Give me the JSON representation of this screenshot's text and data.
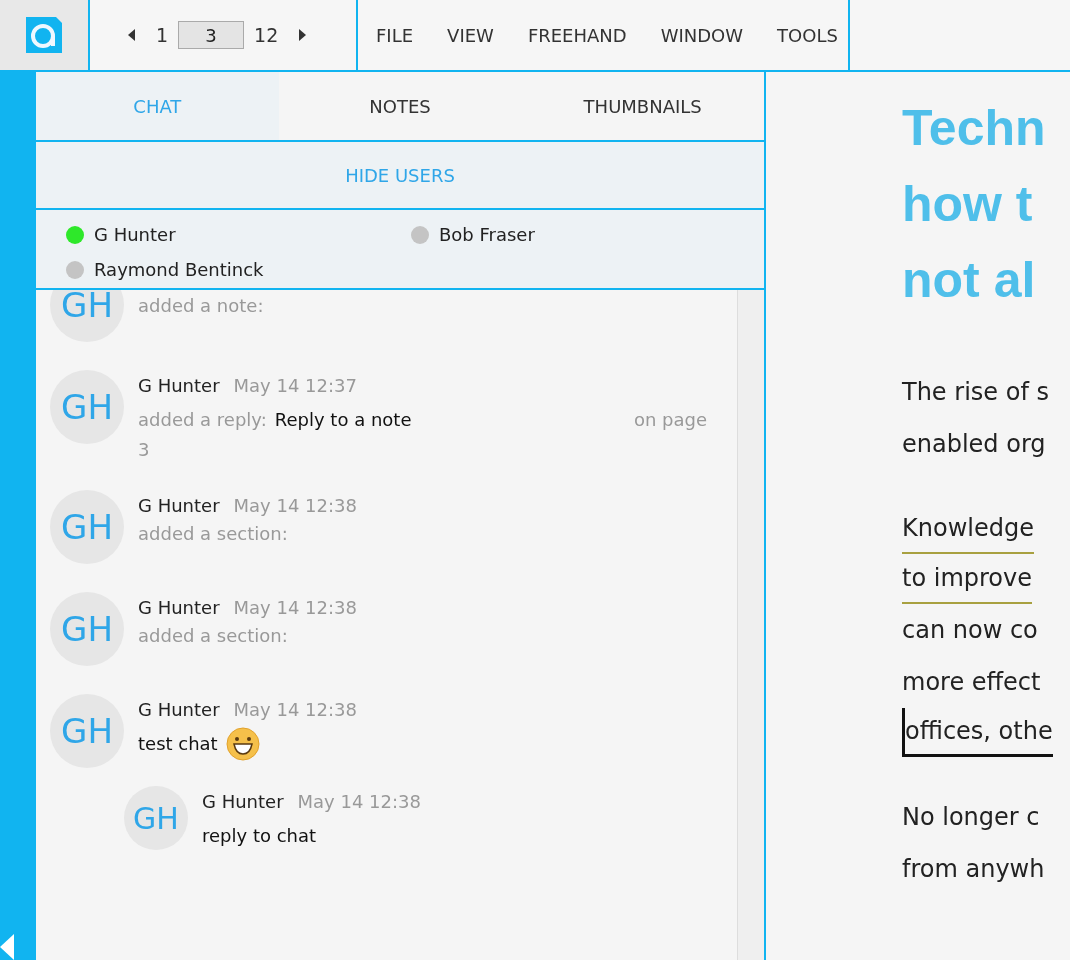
{
  "pager": {
    "first": "1",
    "current": "3",
    "last": "12"
  },
  "menu": [
    "FILE",
    "VIEW",
    "FREEHAND",
    "WINDOW",
    "TOOLS"
  ],
  "tabs": [
    {
      "label": "CHAT",
      "selected": true
    },
    {
      "label": "NOTES",
      "selected": false
    },
    {
      "label": "THUMBNAILS",
      "selected": false
    }
  ],
  "hide_users": "HIDE USERS",
  "users": [
    {
      "name": "G Hunter",
      "online": true
    },
    {
      "name": "Bob Fraser",
      "online": false
    },
    {
      "name": "Raymond Bentinck",
      "online": false
    }
  ],
  "chat": [
    {
      "initials": "GH",
      "action": "added a note:"
    },
    {
      "initials": "GH",
      "author": "G Hunter",
      "time": "May 14 12:37",
      "action": "added a reply:",
      "content": "Reply to a note",
      "page_label": "on page",
      "page_number": "3"
    },
    {
      "initials": "GH",
      "author": "G Hunter",
      "time": "May 14 12:38",
      "action": "added a section:"
    },
    {
      "initials": "GH",
      "author": "G Hunter",
      "time": "May 14 12:38",
      "action": "added a section:"
    },
    {
      "initials": "GH",
      "author": "G Hunter",
      "time": "May 14 12:38",
      "content": "test chat",
      "emoji": true,
      "children": [
        {
          "initials": "GH",
          "author": "G Hunter",
          "time": "May 14 12:38",
          "content": "reply to chat"
        }
      ]
    }
  ],
  "document": {
    "title": [
      "Techn",
      "how t",
      "not al"
    ],
    "paragraphs": [
      [
        {
          "text": "The rise of s",
          "kind": "plain"
        },
        {
          "text": "enabled org",
          "kind": "plain"
        }
      ],
      [
        {
          "text": "Knowledge",
          "kind": "highlight"
        },
        {
          "text": "to improve",
          "kind": "highlight"
        },
        {
          "text": "can now co",
          "kind": "plain"
        },
        {
          "text": "more effect",
          "kind": "plain"
        },
        {
          "text": "offices, othe",
          "kind": "comment"
        }
      ],
      [
        {
          "text": "No longer c",
          "kind": "plain"
        },
        {
          "text": "from anywh",
          "kind": "plain"
        }
      ]
    ]
  }
}
